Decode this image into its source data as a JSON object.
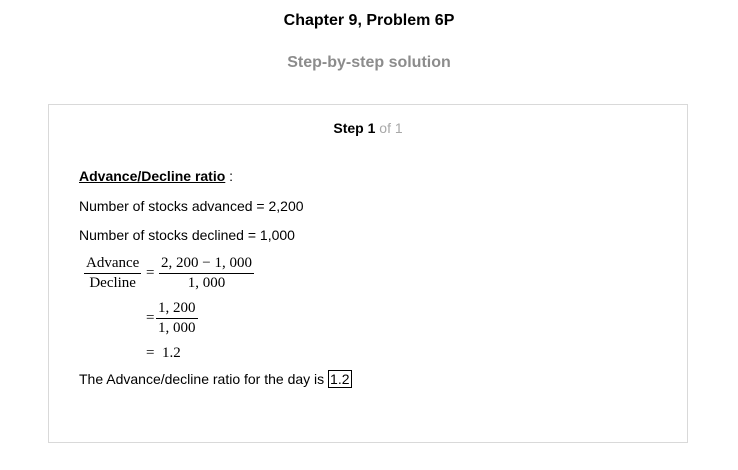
{
  "header": {
    "title": "Chapter 9, Problem 6P",
    "subtitle": "Step-by-step solution"
  },
  "step": {
    "label": "Step",
    "number": "1",
    "of_text": "of 1"
  },
  "content": {
    "heading": "Advance/Decline ratio",
    "heading_colon": ":",
    "advanced_line": "Number of stocks advanced = 2,200",
    "declined_line": "Number of stocks declined = 1,000",
    "eq1": {
      "lhs_num": "Advance",
      "lhs_den": "Decline",
      "equals": "=",
      "rhs_num": "2, 200 − 1, 000",
      "rhs_den": "1, 000"
    },
    "eq2": {
      "equals": "=",
      "num": "1, 200",
      "den": "1, 000"
    },
    "eq3": {
      "equals": "=",
      "value": "1.2"
    },
    "final_text": "The Advance/decline ratio for the day is",
    "final_value": "1.2"
  }
}
